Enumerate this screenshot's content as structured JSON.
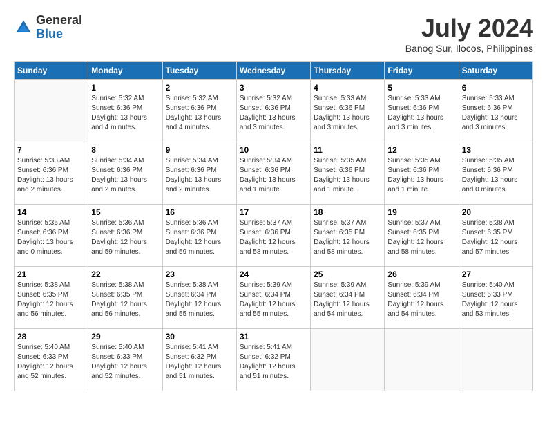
{
  "header": {
    "logo_general": "General",
    "logo_blue": "Blue",
    "month_year": "July 2024",
    "location": "Banog Sur, Ilocos, Philippines"
  },
  "weekdays": [
    "Sunday",
    "Monday",
    "Tuesday",
    "Wednesday",
    "Thursday",
    "Friday",
    "Saturday"
  ],
  "weeks": [
    [
      {
        "day": "",
        "info": ""
      },
      {
        "day": "1",
        "info": "Sunrise: 5:32 AM\nSunset: 6:36 PM\nDaylight: 13 hours\nand 4 minutes."
      },
      {
        "day": "2",
        "info": "Sunrise: 5:32 AM\nSunset: 6:36 PM\nDaylight: 13 hours\nand 4 minutes."
      },
      {
        "day": "3",
        "info": "Sunrise: 5:32 AM\nSunset: 6:36 PM\nDaylight: 13 hours\nand 3 minutes."
      },
      {
        "day": "4",
        "info": "Sunrise: 5:33 AM\nSunset: 6:36 PM\nDaylight: 13 hours\nand 3 minutes."
      },
      {
        "day": "5",
        "info": "Sunrise: 5:33 AM\nSunset: 6:36 PM\nDaylight: 13 hours\nand 3 minutes."
      },
      {
        "day": "6",
        "info": "Sunrise: 5:33 AM\nSunset: 6:36 PM\nDaylight: 13 hours\nand 3 minutes."
      }
    ],
    [
      {
        "day": "7",
        "info": "Sunrise: 5:33 AM\nSunset: 6:36 PM\nDaylight: 13 hours\nand 2 minutes."
      },
      {
        "day": "8",
        "info": "Sunrise: 5:34 AM\nSunset: 6:36 PM\nDaylight: 13 hours\nand 2 minutes."
      },
      {
        "day": "9",
        "info": "Sunrise: 5:34 AM\nSunset: 6:36 PM\nDaylight: 13 hours\nand 2 minutes."
      },
      {
        "day": "10",
        "info": "Sunrise: 5:34 AM\nSunset: 6:36 PM\nDaylight: 13 hours\nand 1 minute."
      },
      {
        "day": "11",
        "info": "Sunrise: 5:35 AM\nSunset: 6:36 PM\nDaylight: 13 hours\nand 1 minute."
      },
      {
        "day": "12",
        "info": "Sunrise: 5:35 AM\nSunset: 6:36 PM\nDaylight: 13 hours\nand 1 minute."
      },
      {
        "day": "13",
        "info": "Sunrise: 5:35 AM\nSunset: 6:36 PM\nDaylight: 13 hours\nand 0 minutes."
      }
    ],
    [
      {
        "day": "14",
        "info": "Sunrise: 5:36 AM\nSunset: 6:36 PM\nDaylight: 13 hours\nand 0 minutes."
      },
      {
        "day": "15",
        "info": "Sunrise: 5:36 AM\nSunset: 6:36 PM\nDaylight: 12 hours\nand 59 minutes."
      },
      {
        "day": "16",
        "info": "Sunrise: 5:36 AM\nSunset: 6:36 PM\nDaylight: 12 hours\nand 59 minutes."
      },
      {
        "day": "17",
        "info": "Sunrise: 5:37 AM\nSunset: 6:36 PM\nDaylight: 12 hours\nand 58 minutes."
      },
      {
        "day": "18",
        "info": "Sunrise: 5:37 AM\nSunset: 6:35 PM\nDaylight: 12 hours\nand 58 minutes."
      },
      {
        "day": "19",
        "info": "Sunrise: 5:37 AM\nSunset: 6:35 PM\nDaylight: 12 hours\nand 58 minutes."
      },
      {
        "day": "20",
        "info": "Sunrise: 5:38 AM\nSunset: 6:35 PM\nDaylight: 12 hours\nand 57 minutes."
      }
    ],
    [
      {
        "day": "21",
        "info": "Sunrise: 5:38 AM\nSunset: 6:35 PM\nDaylight: 12 hours\nand 56 minutes."
      },
      {
        "day": "22",
        "info": "Sunrise: 5:38 AM\nSunset: 6:35 PM\nDaylight: 12 hours\nand 56 minutes."
      },
      {
        "day": "23",
        "info": "Sunrise: 5:38 AM\nSunset: 6:34 PM\nDaylight: 12 hours\nand 55 minutes."
      },
      {
        "day": "24",
        "info": "Sunrise: 5:39 AM\nSunset: 6:34 PM\nDaylight: 12 hours\nand 55 minutes."
      },
      {
        "day": "25",
        "info": "Sunrise: 5:39 AM\nSunset: 6:34 PM\nDaylight: 12 hours\nand 54 minutes."
      },
      {
        "day": "26",
        "info": "Sunrise: 5:39 AM\nSunset: 6:34 PM\nDaylight: 12 hours\nand 54 minutes."
      },
      {
        "day": "27",
        "info": "Sunrise: 5:40 AM\nSunset: 6:33 PM\nDaylight: 12 hours\nand 53 minutes."
      }
    ],
    [
      {
        "day": "28",
        "info": "Sunrise: 5:40 AM\nSunset: 6:33 PM\nDaylight: 12 hours\nand 52 minutes."
      },
      {
        "day": "29",
        "info": "Sunrise: 5:40 AM\nSunset: 6:33 PM\nDaylight: 12 hours\nand 52 minutes."
      },
      {
        "day": "30",
        "info": "Sunrise: 5:41 AM\nSunset: 6:32 PM\nDaylight: 12 hours\nand 51 minutes."
      },
      {
        "day": "31",
        "info": "Sunrise: 5:41 AM\nSunset: 6:32 PM\nDaylight: 12 hours\nand 51 minutes."
      },
      {
        "day": "",
        "info": ""
      },
      {
        "day": "",
        "info": ""
      },
      {
        "day": "",
        "info": ""
      }
    ]
  ]
}
